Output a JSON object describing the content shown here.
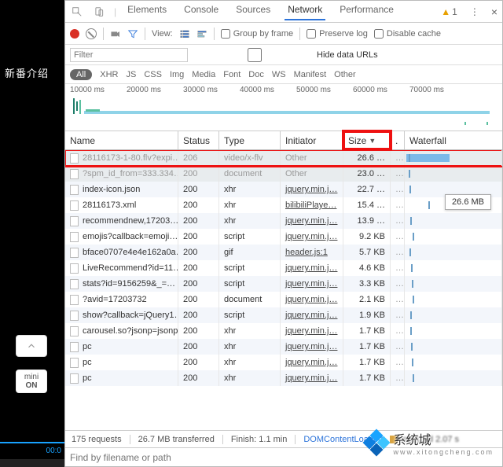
{
  "left": {
    "title": "新番介绍",
    "mini_line1": "mini",
    "mini_line2": "ON",
    "time": "00:0"
  },
  "tabs": {
    "items": [
      "Elements",
      "Console",
      "Sources",
      "Network",
      "Performance"
    ],
    "active": 3,
    "warn_count": "1"
  },
  "toolbar": {
    "view_label": "View:",
    "group_label": "Group by frame",
    "preserve_label": "Preserve log",
    "disable_label": "Disable cache"
  },
  "filter": {
    "placeholder": "Filter",
    "hide_label": "Hide data URLs"
  },
  "types": {
    "all": "All",
    "items": [
      "XHR",
      "JS",
      "CSS",
      "Img",
      "Media",
      "Font",
      "Doc",
      "WS",
      "Manifest",
      "Other"
    ]
  },
  "timeline_ticks": [
    "10000 ms",
    "20000 ms",
    "30000 ms",
    "40000 ms",
    "50000 ms",
    "60000 ms",
    "70000 ms"
  ],
  "columns": {
    "name": "Name",
    "status": "Status",
    "type": "Type",
    "initiator": "Initiator",
    "size": "Size",
    "waterfall": "Waterfall"
  },
  "tooltip": "26.6 MB",
  "rows": [
    {
      "name": "28116173-1-80.flv?expi…",
      "status": "206",
      "type": "video/x-flv",
      "initiator": "Other",
      "init_link": false,
      "size": "26.6 …",
      "wbar": 55,
      "wtick": 5,
      "sel": true,
      "hl": true,
      "dim": true
    },
    {
      "name": "?spm_id_from=333.334…",
      "status": "200",
      "type": "document",
      "initiator": "Other",
      "init_link": false,
      "size": "23.0 …",
      "wtick": 5,
      "sel": true,
      "dim": true
    },
    {
      "name": "index-icon.json",
      "status": "200",
      "type": "xhr",
      "initiator": "jquery.min.j…",
      "init_link": true,
      "size": "22.7 …",
      "wtick": 6
    },
    {
      "name": "28116173.xml",
      "status": "200",
      "type": "xhr",
      "initiator": "bilibiliPlaye…",
      "init_link": true,
      "size": "15.4 …",
      "wtick": 30
    },
    {
      "name": "recommendnew,17203…",
      "status": "200",
      "type": "xhr",
      "initiator": "jquery.min.j…",
      "init_link": true,
      "size": "13.9 …",
      "wtick": 7
    },
    {
      "name": "emojis?callback=emoji…",
      "status": "200",
      "type": "script",
      "initiator": "jquery.min.j…",
      "init_link": true,
      "size": "9.2 KB",
      "wtick": 10
    },
    {
      "name": "bface0707e4e4e162a0a…",
      "status": "200",
      "type": "gif",
      "initiator": "header.js:1",
      "init_link": true,
      "size": "5.7 KB",
      "wtick": 6
    },
    {
      "name": "LiveRecommend?id=11…",
      "status": "200",
      "type": "script",
      "initiator": "jquery.min.j…",
      "init_link": true,
      "size": "4.6 KB",
      "wtick": 8
    },
    {
      "name": "stats?id=9156259&_=…",
      "status": "200",
      "type": "script",
      "initiator": "jquery.min.j…",
      "init_link": true,
      "size": "3.3 KB",
      "wtick": 9
    },
    {
      "name": "?avid=17203732",
      "status": "200",
      "type": "document",
      "initiator": "jquery.min.j…",
      "init_link": true,
      "size": "2.1 KB",
      "wtick": 10
    },
    {
      "name": "show?callback=jQuery1…",
      "status": "200",
      "type": "script",
      "initiator": "jquery.min.j…",
      "init_link": true,
      "size": "1.9 KB",
      "wtick": 7
    },
    {
      "name": "carousel.so?jsonp=jsonp",
      "status": "200",
      "type": "xhr",
      "initiator": "jquery.min.j…",
      "init_link": true,
      "size": "1.7 KB",
      "wtick": 7
    },
    {
      "name": "pc",
      "status": "200",
      "type": "xhr",
      "initiator": "jquery.min.j…",
      "init_link": true,
      "size": "1.7 KB",
      "wtick": 8
    },
    {
      "name": "pc",
      "status": "200",
      "type": "xhr",
      "initiator": "jquery.min.j…",
      "init_link": true,
      "size": "1.7 KB",
      "wtick": 9
    },
    {
      "name": "pc",
      "status": "200",
      "type": "xhr",
      "initiator": "jquery.min.j…",
      "init_link": true,
      "size": "1.7 KB",
      "wtick": 10
    }
  ],
  "status": {
    "requests": "175 requests",
    "transferred": "26.7 MB transferred",
    "finish": "Finish: 1.1 min",
    "dom": "DOMContentLoaded:",
    "rest": "ms   L  ad  2.07 s"
  },
  "find_placeholder": "Find by filename or path",
  "watermark": {
    "big": "系统城",
    "small": "www.xitongcheng.com"
  }
}
